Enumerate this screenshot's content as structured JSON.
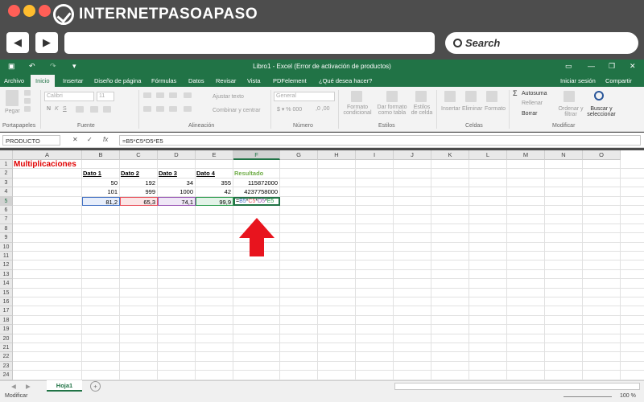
{
  "browser": {
    "site_logo": "INTERNETPASOAPASO",
    "search_label": "Search",
    "back_icon": "arrow-left-icon",
    "forward_icon": "arrow-right-icon"
  },
  "excel": {
    "window_title": "Libro1 - Excel (Error de activación de productos)",
    "tabs": [
      "Archivo",
      "Inicio",
      "Insertar",
      "Diseño de página",
      "Fórmulas",
      "Datos",
      "Revisar",
      "Vista",
      "PDFelement",
      "¿Qué desea hacer?"
    ],
    "active_tab": "Inicio",
    "signin": "Iniciar sesión",
    "share": "Compartir",
    "ribbon": {
      "paste": "Pegar",
      "font_name": "Calibri",
      "font_size": "11",
      "wrap_text": "Ajustar texto",
      "merge_center": "Combinar y centrar",
      "number_format": "General",
      "cond_format": "Formato condicional",
      "table_format": "Dar formato como tabla",
      "cell_styles": "Estilos de celda",
      "insert": "Insertar",
      "delete": "Eliminar",
      "format": "Formato",
      "autosum": "Autosuma",
      "fill": "Rellenar",
      "clear": "Borrar",
      "sort_filter": "Ordenar y filtrar",
      "find_select": "Buscar y seleccionar",
      "groups": [
        "Portapapeles",
        "Fuente",
        "Alineación",
        "Número",
        "Estilos",
        "Celdas",
        "Modificar"
      ]
    },
    "name_box": "PRODUCTO",
    "formula": "=B5*C5*D5*E5",
    "columns": [
      "A",
      "B",
      "C",
      "D",
      "E",
      "F",
      "G",
      "H",
      "I",
      "J",
      "K",
      "L",
      "M",
      "N",
      "O"
    ],
    "rows": [
      "1",
      "2",
      "3",
      "4",
      "5",
      "6",
      "7",
      "8",
      "9",
      "10",
      "11",
      "12",
      "13",
      "14",
      "15",
      "16",
      "17",
      "18",
      "19",
      "20",
      "21",
      "22",
      "23",
      "24"
    ],
    "cells": {
      "title": "Multiplicaciones",
      "headers": [
        "Dato 1",
        "Dato 2",
        "Dato 3",
        "Dato 4",
        "Resultado"
      ],
      "r3": [
        "50",
        "192",
        "34",
        "355",
        "115872000"
      ],
      "r4": [
        "101",
        "999",
        "1000",
        "42",
        "4237758000"
      ],
      "r5": [
        "81,2",
        "65,3",
        "74,1",
        "99,9"
      ],
      "f5_parts": [
        "=",
        "B5",
        "*",
        "C5",
        "*",
        "D5",
        "*",
        "E5"
      ]
    },
    "sheet_name": "Hoja1",
    "status_mode": "Modificar",
    "zoom": "100 %",
    "colors": {
      "green": "#217346",
      "title_red": "#e00000",
      "result_green": "#70ad47",
      "arrow_red": "#e8141e"
    }
  }
}
